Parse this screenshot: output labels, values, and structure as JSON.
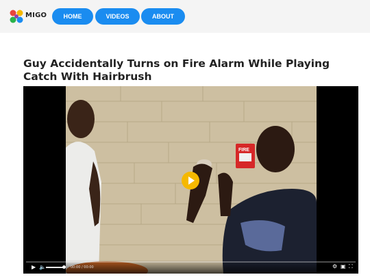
{
  "header": {
    "logo_text": "MIGO",
    "nav": [
      {
        "label": "HOME"
      },
      {
        "label": "VIDEOS"
      },
      {
        "label": "ABOUT"
      }
    ]
  },
  "article": {
    "title": "Guy Accidentally Turns on Fire Alarm While Playing Catch With Hairbrush"
  },
  "player": {
    "time": "00:00 / 00:00",
    "sign_text": "FIRE",
    "icons": [
      "play-icon",
      "volume-icon",
      "settings-icon",
      "pip-icon",
      "fullscreen-icon"
    ],
    "accent": "#f5b800"
  },
  "colors": {
    "nav_button": "#1a8cf0",
    "header_bg": "#f4f4f4"
  }
}
